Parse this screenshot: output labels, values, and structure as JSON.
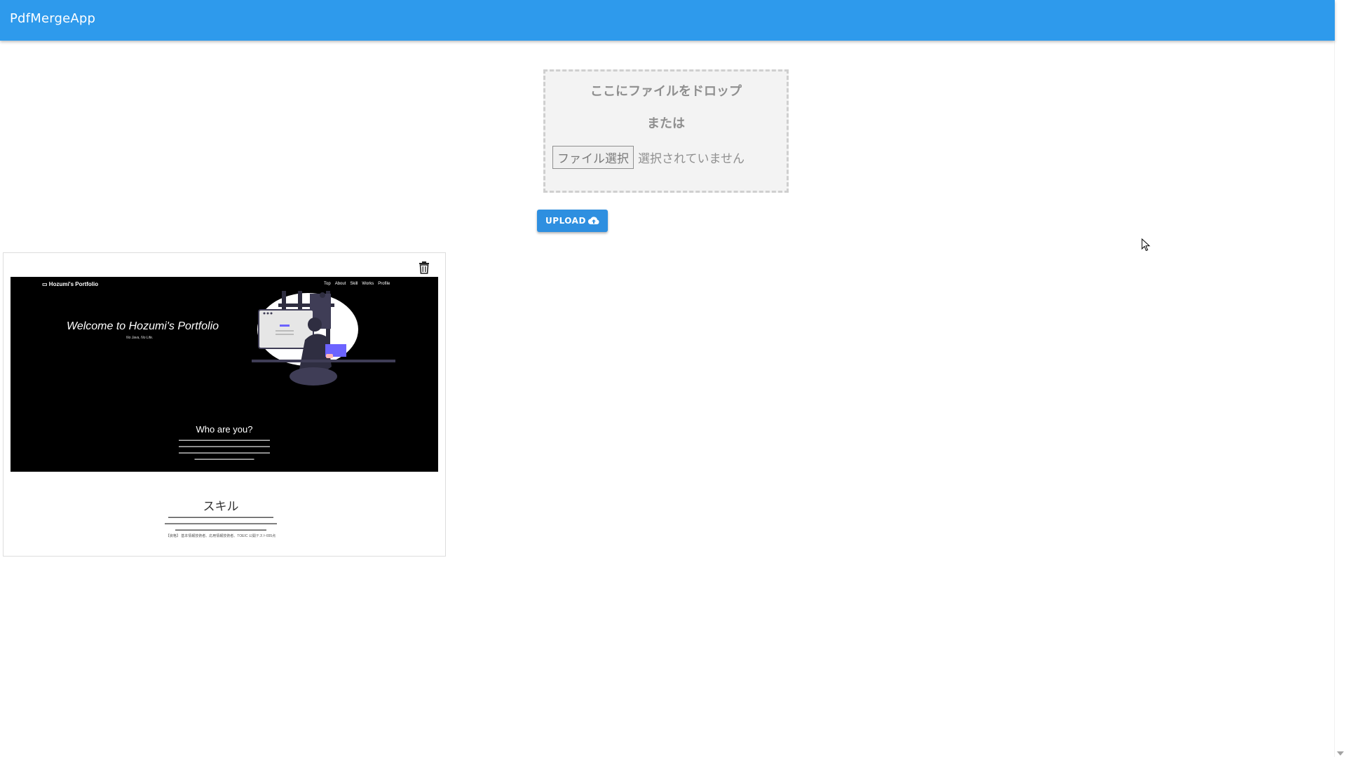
{
  "app": {
    "title": "PdfMergeApp"
  },
  "dropzone": {
    "drop_text": "ここにファイルをドロップ",
    "or_text": "または",
    "file_button": "ファイル選択",
    "file_status": "選択されていません"
  },
  "upload": {
    "label": "UPLOAD",
    "icon": "cloud-upload-icon"
  },
  "pdf_preview": {
    "delete_icon": "trash-icon",
    "page": {
      "site_logo": "Hozumi's Portfolio",
      "nav": [
        "Top",
        "About",
        "Skill",
        "Works",
        "Profile"
      ],
      "welcome": "Welcome to Hozumi's Portfolio",
      "subtitle": "No Java, No Life.",
      "who_title": "Who are you?",
      "skill_title": "スキル",
      "skill_note": "【資格】 基本情報技術者、応用情報技術者、TOEIC 公開テスト655点"
    }
  },
  "colors": {
    "appbar": "#2e9aec",
    "upload_button": "#2e8fe0"
  }
}
